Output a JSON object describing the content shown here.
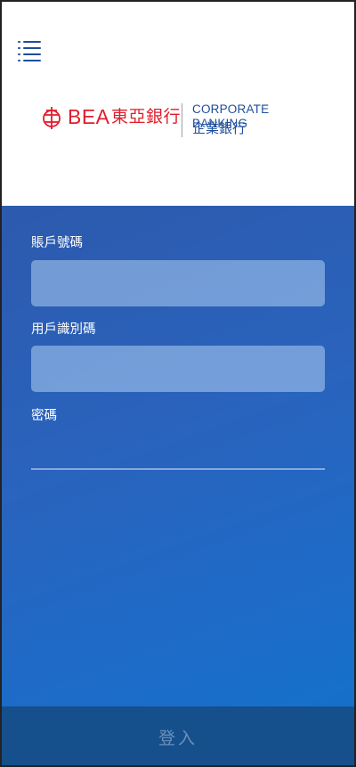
{
  "header": {
    "logo": {
      "brand": "BEA",
      "brand_cn": "東亞銀行",
      "product": "CORPORATE BANKING",
      "product_cn": "企業銀行"
    }
  },
  "form": {
    "account_number": {
      "label": "賬戶號碼",
      "value": ""
    },
    "user_id": {
      "label": "用戶識別碼",
      "value": ""
    },
    "password": {
      "label": "密碼",
      "value": ""
    }
  },
  "login_button": {
    "label": "登入"
  },
  "colors": {
    "brand_red": "#e01e2b",
    "brand_blue": "#1e4e9c",
    "panel_blue": "#2a63bd",
    "login_bar": "#15508d"
  },
  "icons": {
    "menu": "menu-icon",
    "logo_mark": "bea-logo-icon"
  }
}
